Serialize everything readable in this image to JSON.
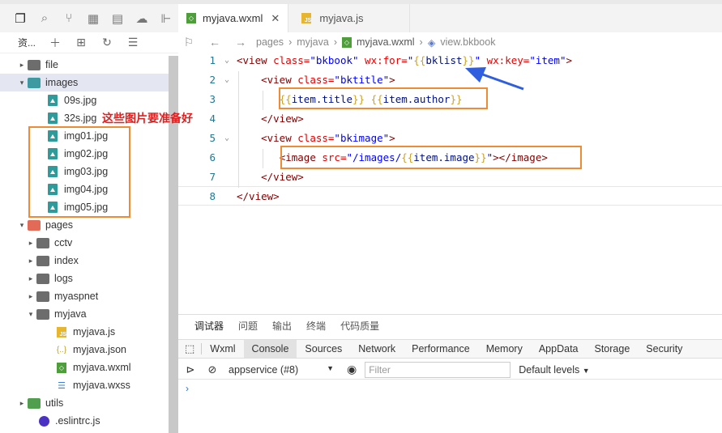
{
  "activity_bar": {
    "icons": [
      "files-icon",
      "search-icon",
      "source-control-icon",
      "extensions-icon",
      "save-icon",
      "docker-icon",
      "debug-icon"
    ]
  },
  "explorer": {
    "title": "资..."
  },
  "tree": {
    "items": [
      {
        "label": "file",
        "depth": 0,
        "type": "folder-grey",
        "expanded": false
      },
      {
        "label": "images",
        "depth": 0,
        "type": "folder-teal",
        "expanded": true,
        "selected": true
      },
      {
        "label": "09s.jpg",
        "depth": 1,
        "type": "image"
      },
      {
        "label": "32s.jpg",
        "depth": 1,
        "type": "image"
      },
      {
        "label": "img01.jpg",
        "depth": 1,
        "type": "image"
      },
      {
        "label": "img02.jpg",
        "depth": 1,
        "type": "image"
      },
      {
        "label": "img03.jpg",
        "depth": 1,
        "type": "image"
      },
      {
        "label": "img04.jpg",
        "depth": 1,
        "type": "image"
      },
      {
        "label": "img05.jpg",
        "depth": 1,
        "type": "image"
      },
      {
        "label": "pages",
        "depth": 0,
        "type": "folder-red",
        "expanded": true
      },
      {
        "label": "cctv",
        "depth": 1,
        "type": "folder-grey",
        "expanded": false
      },
      {
        "label": "index",
        "depth": 1,
        "type": "folder-grey",
        "expanded": false
      },
      {
        "label": "logs",
        "depth": 1,
        "type": "folder-grey",
        "expanded": false
      },
      {
        "label": "myaspnet",
        "depth": 1,
        "type": "folder-grey",
        "expanded": false
      },
      {
        "label": "myjava",
        "depth": 1,
        "type": "folder-grey",
        "expanded": true
      },
      {
        "label": "myjava.js",
        "depth": 2,
        "type": "js"
      },
      {
        "label": "myjava.json",
        "depth": 2,
        "type": "json"
      },
      {
        "label": "myjava.wxml",
        "depth": 2,
        "type": "wxml"
      },
      {
        "label": "myjava.wxss",
        "depth": 2,
        "type": "wxss"
      },
      {
        "label": "utils",
        "depth": 0,
        "type": "folder-green",
        "expanded": false
      },
      {
        "label": ".eslintrc.js",
        "depth": 0,
        "type": "eslint"
      }
    ]
  },
  "annotation": {
    "note": "这些图片要准备好"
  },
  "tabs": [
    {
      "label": "myjava.wxml",
      "active": true,
      "icon": "wxml"
    },
    {
      "label": "myjava.js",
      "active": false,
      "icon": "js"
    }
  ],
  "breadcrumb": {
    "items": [
      "pages",
      "myjava",
      "myjava.wxml",
      "view.bkbook"
    ]
  },
  "code": {
    "lines": [
      {
        "n": "1",
        "fold": "⌄",
        "tokens": [
          [
            "tag",
            "<view "
          ],
          [
            "attr",
            "class="
          ],
          [
            "str",
            "\"bkbook\""
          ],
          [
            "attr",
            " wx:for="
          ],
          [
            "str",
            "\""
          ],
          [
            "brace",
            "{{"
          ],
          [
            "expr",
            "bklist"
          ],
          [
            "brace",
            "}}"
          ],
          [
            "str",
            "\""
          ],
          [
            "attr",
            " wx:key="
          ],
          [
            "str",
            "\"item\""
          ],
          [
            "tag",
            ">"
          ]
        ]
      },
      {
        "n": "2",
        "fold": "⌄",
        "tokens": [
          [
            "ctext",
            "    "
          ],
          [
            "tag",
            "<view "
          ],
          [
            "attr",
            "class="
          ],
          [
            "str",
            "\"bktitle\""
          ],
          [
            "tag",
            ">"
          ]
        ]
      },
      {
        "n": "3",
        "fold": "",
        "tokens": [
          [
            "ctext",
            "       "
          ],
          [
            "brace",
            "{{"
          ],
          [
            "expr",
            "item.title"
          ],
          [
            "brace",
            "}}"
          ],
          [
            "ctext",
            " "
          ],
          [
            "brace",
            "{{"
          ],
          [
            "expr",
            "item.author"
          ],
          [
            "brace",
            "}}"
          ]
        ]
      },
      {
        "n": "4",
        "fold": "",
        "tokens": [
          [
            "ctext",
            "    "
          ],
          [
            "tag",
            "</view>"
          ]
        ]
      },
      {
        "n": "5",
        "fold": "⌄",
        "tokens": [
          [
            "ctext",
            "    "
          ],
          [
            "tag",
            "<view "
          ],
          [
            "attr",
            "class="
          ],
          [
            "str",
            "\"bkimage\""
          ],
          [
            "tag",
            ">"
          ]
        ]
      },
      {
        "n": "6",
        "fold": "",
        "tokens": [
          [
            "ctext",
            "       "
          ],
          [
            "tag",
            "<image "
          ],
          [
            "attr",
            "src="
          ],
          [
            "str",
            "\"/images/"
          ],
          [
            "brace",
            "{{"
          ],
          [
            "expr",
            "item.image"
          ],
          [
            "brace",
            "}}"
          ],
          [
            "str",
            "\""
          ],
          [
            "tag",
            "></image>"
          ]
        ]
      },
      {
        "n": "7",
        "fold": "",
        "tokens": [
          [
            "ctext",
            "    "
          ],
          [
            "tag",
            "</view>"
          ]
        ]
      },
      {
        "n": "8",
        "fold": "",
        "tokens": [
          [
            "tag",
            "</view>"
          ]
        ]
      }
    ]
  },
  "panel": {
    "tabs": [
      "调试器",
      "问题",
      "输出",
      "终端",
      "代码质量"
    ],
    "devtools_tabs": [
      "Wxml",
      "Console",
      "Sources",
      "Network",
      "Performance",
      "Memory",
      "AppData",
      "Storage",
      "Security"
    ],
    "context": "appservice (#8)",
    "filter_placeholder": "Filter",
    "levels": "Default levels"
  },
  "colors": {
    "annotation_box": "#ef8b35",
    "annotation_text": "#e02020",
    "arrow": "#2f5fde"
  }
}
